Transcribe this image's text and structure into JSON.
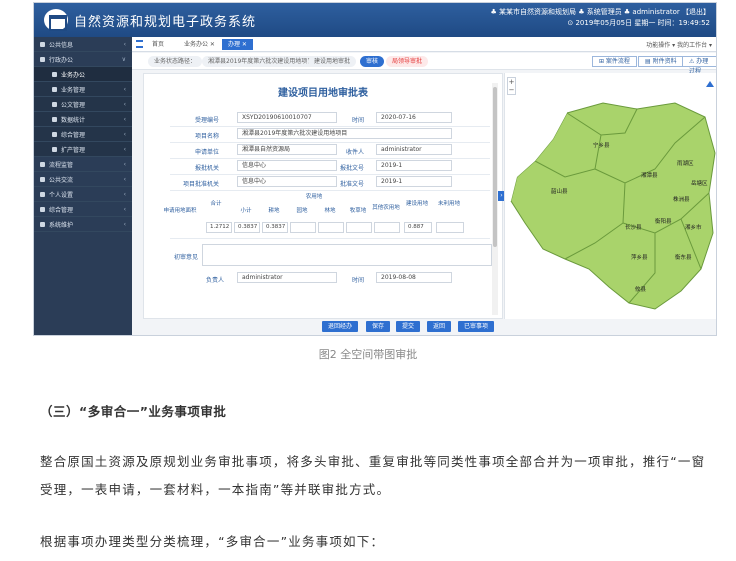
{
  "app": {
    "title": "自然资源和规划电子政务系统",
    "top_right_line1": "♣ 某某市自然资源和规划局  ♣ 系统管理员  ♣ administrator 【退出】",
    "top_right_line2": "⊙ 2019年05月05日 星期一  时间：19:49:52"
  },
  "tabs": {
    "home": "首页",
    "pending": "业务办公 ✕",
    "process": "办理 ✕",
    "right": "功能操作 ▾   我的工作台 ▾"
  },
  "sidebar": {
    "items": [
      {
        "label": "公共信息",
        "arrow": "‹"
      },
      {
        "label": "行政办公",
        "arrow": "∨"
      },
      {
        "label": "业务办公",
        "arrow": ""
      },
      {
        "label": "业务管理",
        "arrow": "‹"
      },
      {
        "label": "公文管理",
        "arrow": "‹"
      },
      {
        "label": "数据统计",
        "arrow": "‹"
      },
      {
        "label": "综合管理",
        "arrow": "‹"
      },
      {
        "label": "扩产管理",
        "arrow": "‹"
      },
      {
        "label": "流程监管",
        "arrow": "‹"
      },
      {
        "label": "公共交流",
        "arrow": "‹"
      },
      {
        "label": "个人设置",
        "arrow": "‹"
      },
      {
        "label": "综合管理",
        "arrow": "‹"
      },
      {
        "label": "系统维护",
        "arrow": "‹"
      }
    ]
  },
  "breadcrumb": {
    "items": [
      {
        "label": "业务状态路径："
      },
      {
        "label": "湘潭县2019年度第六批次建设用地项目"
      },
      {
        "label": "建设用地审批"
      },
      {
        "label": "审核"
      },
      {
        "label": "局领导审批"
      }
    ],
    "tools": [
      "⊞ 案件流程",
      "▤ 附件资料",
      "⚠ 办理过程"
    ]
  },
  "form": {
    "title": "建设项目用地审批表",
    "fields": {
      "accept_no_label": "受理编号",
      "accept_no": "XSYD20190610010707",
      "time_label": "时间",
      "time": "2020-07-16",
      "project_label": "项目名称",
      "project": "湘潭县2019年度第六批次建设用地项目",
      "applicant_label": "申请单位",
      "applicant": "湘潭县自然资源局",
      "recipient_label": "收件人",
      "recipient": "administrator",
      "report_org_label": "报批机关",
      "report_org": "信息中心",
      "report_doc_label": "报批文号",
      "report_doc": "2019-1",
      "approve_org_label": "项目批准机关",
      "approve_org": "信息中心",
      "approve_doc_label": "批准文号",
      "approve_doc": "2019-1"
    },
    "land_table": {
      "row_label": "申请用地面积",
      "total_label": "合计",
      "group_label": "农用地",
      "headers": [
        "小计",
        "耕地",
        "园地",
        "林地",
        "牧草地",
        "其他农用地",
        "建设用地",
        "未利用地"
      ],
      "total": "1.2712",
      "values": [
        "0.3837",
        "0.3837",
        "",
        "",
        "",
        "",
        "0.887",
        ""
      ]
    },
    "opinion_label": "初审意见",
    "owner_label": "负责人",
    "owner": "administrator",
    "date_label": "时间",
    "date": "2019-08-08"
  },
  "buttons": [
    "退回经办",
    "保存",
    "提交",
    "返回",
    "已审事项"
  ],
  "map": {
    "zoom_in": "+",
    "zoom_out": "−",
    "labels": [
      "宁乡县",
      "韶山县",
      "湘潭县",
      "雨湖区",
      "岳塘区",
      "株洲县",
      "长沙县",
      "衡阳县",
      "湘乡市",
      "萍乡县",
      "衡东县",
      "攸县"
    ]
  },
  "caption": "图2 全空间带图审批",
  "article": {
    "heading": "（三）“多审合一”业务事项审批",
    "para1": "整合原国土资源及原规划业务审批事项，将多头审批、重复审批等同类性事项全部合并为一项审批，推行“一窗受理，一表申请，一套材料，一本指南”等并联审批方式。",
    "para2": "根据事项办理类型分类梳理，“多审合一”业务事项如下："
  }
}
